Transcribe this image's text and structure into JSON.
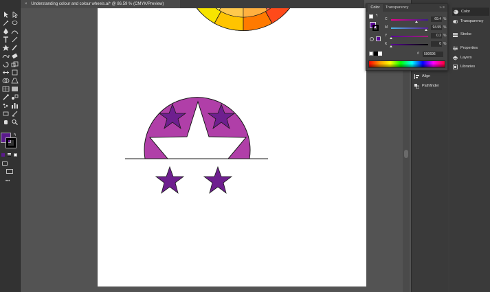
{
  "document": {
    "tab_title": "Understanding colour and colour wheels.ai* @ 86.59 % (CMYK/Preview)",
    "close_glyph": "×"
  },
  "toolbar": {
    "tools": [
      "selection-tool",
      "direct-selection-tool",
      "pen-tool",
      "curvature-tool",
      "type-tool",
      "line-tool",
      "rectangle-tool",
      "paintbrush-tool",
      "shaper-tool",
      "eraser-tool",
      "rotate-tool",
      "scale-tool",
      "width-tool",
      "free-transform-tool",
      "shape-builder-tool",
      "perspective-tool",
      "mesh-tool",
      "gradient-tool",
      "eyedropper-tool",
      "blend-tool",
      "symbol-sprayer-tool",
      "column-graph-tool",
      "artboard-tool",
      "slice-tool",
      "hand-tool",
      "zoom-tool"
    ],
    "fill_color": "#5a1a8c",
    "stroke_color": "#000000",
    "more_label": "•••"
  },
  "color_panel": {
    "tabs": [
      "Color",
      "Transparency"
    ],
    "menu_glyph": "›› ≡",
    "channels": [
      {
        "letter": "C",
        "value": "69.4",
        "fraction": 0.694,
        "track_color": "#00aeef"
      },
      {
        "letter": "M",
        "value": "94.55",
        "fraction": 0.9455,
        "track_color": "#ec008c"
      },
      {
        "letter": "Y",
        "value": "0.2",
        "fraction": 0.002,
        "track_color": "#fff200"
      },
      {
        "letter": "K",
        "value": "0",
        "fraction": 0.0,
        "track_color": "#231f20"
      }
    ],
    "percent_sign": "%",
    "hex_symbol": "#",
    "hex_value": "590696",
    "current_color": "#590696"
  },
  "dock_right": {
    "items": [
      "Color",
      "Transparency",
      "Stroke",
      "Properties",
      "Layers",
      "Libraries"
    ]
  },
  "dock_mid": {
    "items": [
      "Align",
      "Pathfinder"
    ]
  },
  "artwork": {
    "wheel_colors": [
      "#1a8a3a",
      "#f7e400",
      "#ffb400",
      "#ff5a1e",
      "#ff2a00",
      "#fff6a8",
      "#ffd08a",
      "#ff9a8a",
      "#ffe566",
      "#ffc94d",
      "#ff7a59"
    ],
    "purple_light": "#b03fa8",
    "purple_dark": "#6e1f8f",
    "outline": "#1a1a1a"
  }
}
